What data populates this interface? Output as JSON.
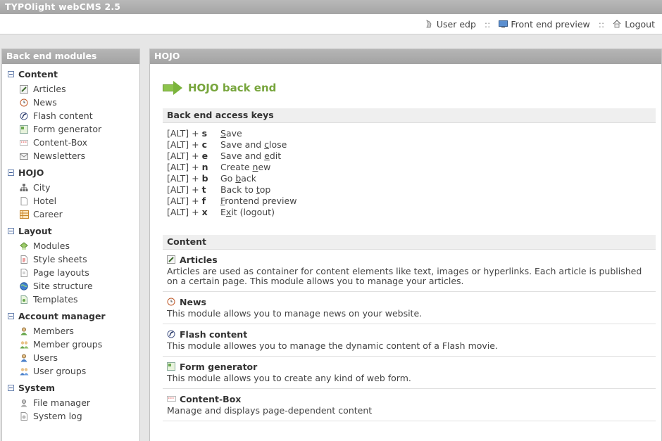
{
  "app": {
    "title": "TYPOlight webCMS 2.5"
  },
  "topnav": {
    "user": "User edp",
    "preview": "Front end preview",
    "logout": "Logout",
    "separator": "::"
  },
  "sidebar": {
    "heading": "Back end modules",
    "groups": [
      {
        "title": "Content",
        "items": [
          "Articles",
          "News",
          "Flash content",
          "Form generator",
          "Content-Box",
          "Newsletters"
        ]
      },
      {
        "title": "HOJO",
        "items": [
          "City",
          "Hotel",
          "Career"
        ]
      },
      {
        "title": "Layout",
        "items": [
          "Modules",
          "Style sheets",
          "Page layouts",
          "Site structure",
          "Templates"
        ]
      },
      {
        "title": "Account manager",
        "items": [
          "Members",
          "Member groups",
          "Users",
          "User groups"
        ]
      },
      {
        "title": "System",
        "items": [
          "File manager",
          "System log"
        ]
      }
    ]
  },
  "main": {
    "heading": "HOJO",
    "page_title": "HOJO back end",
    "keys_heading": "Back end access keys",
    "keys": [
      {
        "prefix": "[ALT] + ",
        "key": "s",
        "pre": "",
        "u": "S",
        "post": "ave"
      },
      {
        "prefix": "[ALT] + ",
        "key": "c",
        "pre": "Save and ",
        "u": "c",
        "post": "lose"
      },
      {
        "prefix": "[ALT] + ",
        "key": "e",
        "pre": "Save and ",
        "u": "e",
        "post": "dit"
      },
      {
        "prefix": "[ALT] + ",
        "key": "n",
        "pre": "Create ",
        "u": "n",
        "post": "ew"
      },
      {
        "prefix": "[ALT] + ",
        "key": "b",
        "pre": "Go ",
        "u": "b",
        "post": "ack"
      },
      {
        "prefix": "[ALT] + ",
        "key": "t",
        "pre": "Back to ",
        "u": "t",
        "post": "op"
      },
      {
        "prefix": "[ALT] + ",
        "key": "f",
        "pre": "",
        "u": "F",
        "post": "rontend preview"
      },
      {
        "prefix": "[ALT] + ",
        "key": "x",
        "pre": "E",
        "u": "x",
        "post": "it (logout)"
      }
    ],
    "content_heading": "Content",
    "modules": [
      {
        "title": "Articles",
        "desc": "Articles are used as container for content elements like text, images or hyperlinks. Each article is published on a certain page. This module allows you to manage your articles."
      },
      {
        "title": "News",
        "desc": "This module allows you to manage news on your website."
      },
      {
        "title": "Flash content",
        "desc": "This module allowes you to manage the dynamic content of a Flash movie."
      },
      {
        "title": "Form generator",
        "desc": "This module allows you to create any kind of web form."
      },
      {
        "title": "Content-Box",
        "desc": "Manage and displays page-dependent content"
      }
    ]
  }
}
